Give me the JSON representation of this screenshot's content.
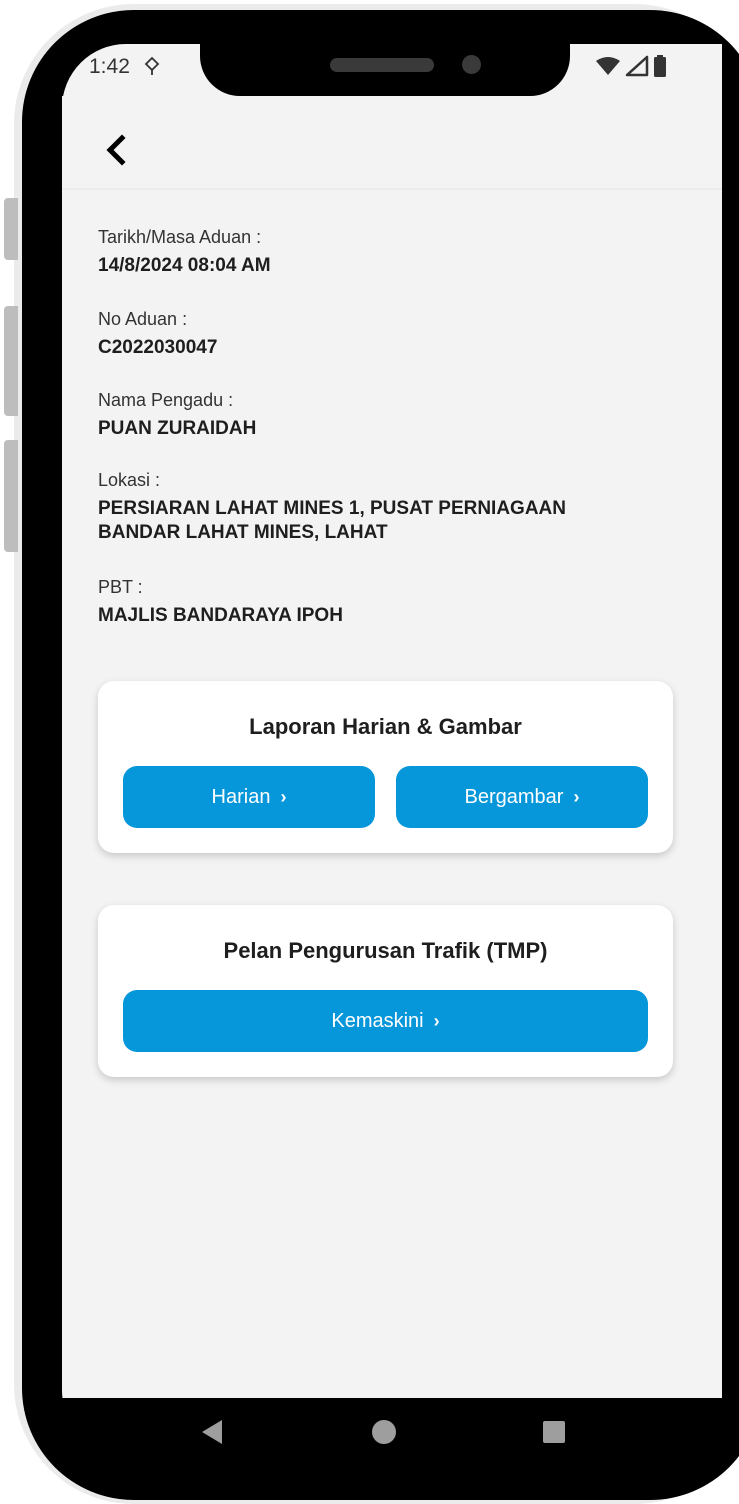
{
  "status_bar": {
    "time": "1:42"
  },
  "fields": [
    {
      "label": "Tarikh/Masa Aduan :",
      "value": "14/8/2024 08:04 AM"
    },
    {
      "label": "No Aduan :",
      "value": "C2022030047"
    },
    {
      "label": "Nama Pengadu :",
      "value": "PUAN ZURAIDAH"
    },
    {
      "label": "Lokasi :",
      "value": "PERSIARAN LAHAT MINES 1, PUSAT PERNIAGAAN BANDAR LAHAT MINES, LAHAT"
    },
    {
      "label": "PBT :",
      "value": "MAJLIS BANDARAYA IPOH"
    }
  ],
  "report_card": {
    "title": "Laporan Harian & Gambar",
    "harian_label": "Harian",
    "bergambar_label": "Bergambar"
  },
  "tmp_card": {
    "title": "Pelan Pengurusan Trafik (TMP)",
    "kemaskini_label": "Kemaskini"
  },
  "chevron": "›",
  "colors": {
    "primary_button": "#0696da",
    "background": "#f3f3f3",
    "card": "#ffffff",
    "text_dark": "#1e1e1e"
  },
  "icons": {
    "back": "chevron-left-icon",
    "status_notification": "notification-icon",
    "status_wifi": "wifi-icon",
    "status_signal": "signal-icon",
    "status_battery": "battery-icon",
    "nav_back": "triangle-back-icon",
    "nav_home": "circle-home-icon",
    "nav_recents": "square-recents-icon"
  }
}
